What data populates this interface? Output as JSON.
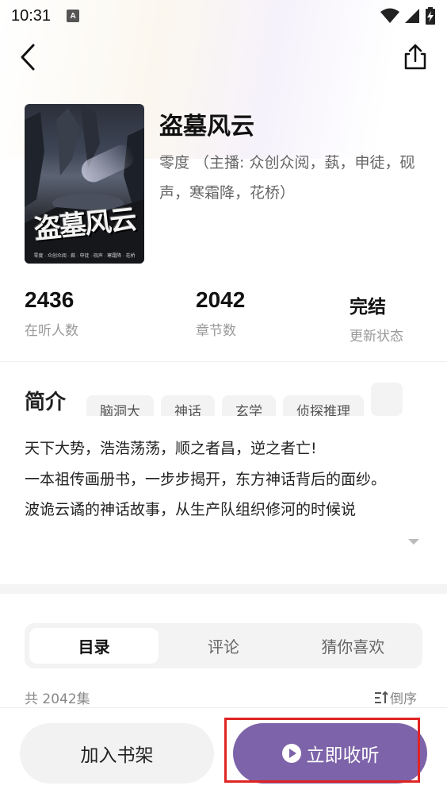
{
  "status_bar": {
    "time": "10:31",
    "notification_badge": "A",
    "icons": [
      "wifi-icon",
      "signal-icon",
      "battery-charging-icon"
    ]
  },
  "nav": {
    "back_icon": "chevron-left-icon",
    "share_icon": "share-icon"
  },
  "book": {
    "title": "盗墓风云",
    "author_line": "零度 （主播: 众创众阅，蓺，申徒，砚声，寒霜降，花桥）",
    "cover": {
      "title_art": "盗墓风云",
      "credits": "零度 · 众创众阅 · 蓺 · 申徒 · 砚声 · 寒霜降 · 花桥"
    }
  },
  "stats": [
    {
      "value": "2436",
      "label": "在听人数"
    },
    {
      "value": "2042",
      "label": "章节数"
    },
    {
      "value": "完结",
      "label": "更新状态"
    }
  ],
  "intro": {
    "heading": "简介",
    "tags": [
      "脑洞大",
      "神话",
      "玄学",
      "侦探推理",
      ""
    ],
    "lines": [
      "天下大势，浩浩荡荡，顺之者昌，逆之者亡!",
      "一本祖传画册书，一步步揭开，东方神话背后的面纱。",
      "波诡云谲的神话故事，从生产队组织修河的时候说"
    ]
  },
  "tabs": [
    {
      "label": "目录",
      "active": true
    },
    {
      "label": "评论",
      "active": false
    },
    {
      "label": "猜你喜欢",
      "active": false
    }
  ],
  "catalog": {
    "episode_count": "共 2042集",
    "sort_label": "倒序"
  },
  "actions": {
    "add_to_shelf": "加入书架",
    "listen_now": "立即收听"
  },
  "colors": {
    "accent": "#7d63a9",
    "highlight_box": "#e02424"
  }
}
